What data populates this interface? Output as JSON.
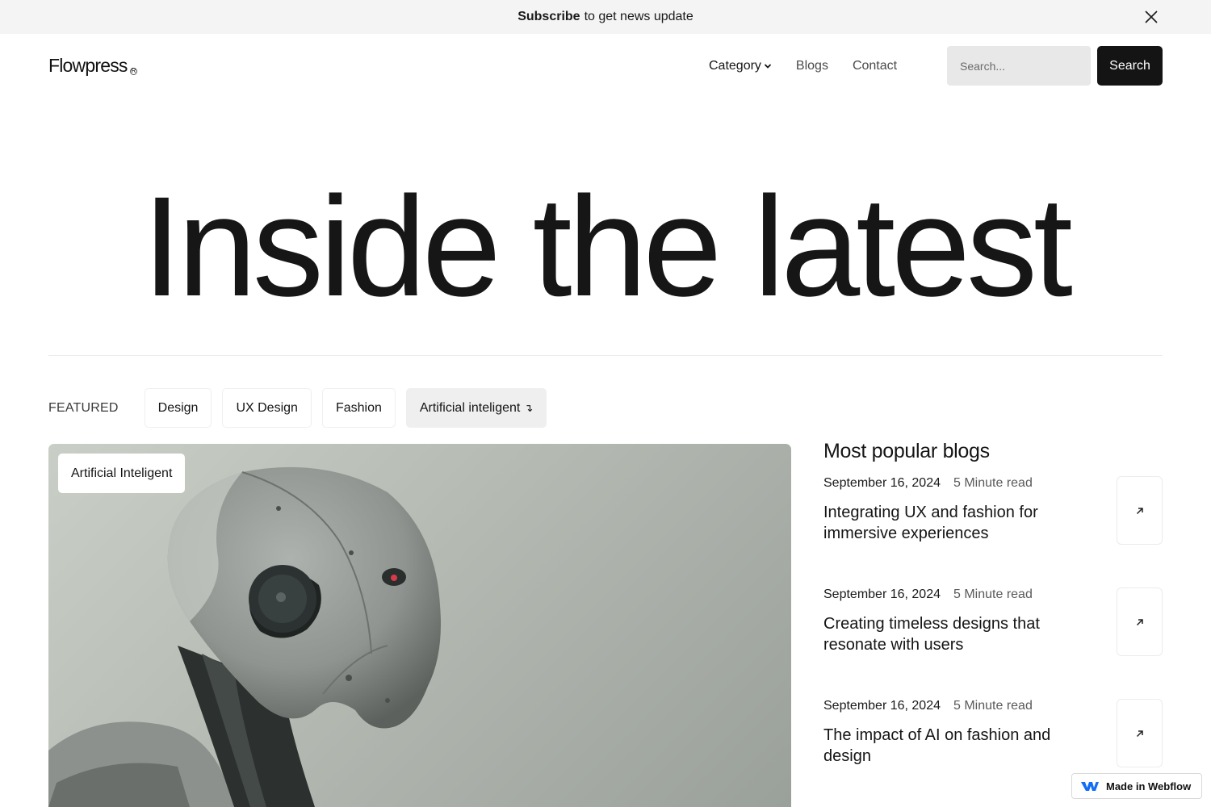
{
  "announcement": {
    "bold": "Subscribe",
    "text": "to get news update"
  },
  "header": {
    "logo": "Flowpress",
    "logo_mark": "R",
    "menu": [
      {
        "label": "Category",
        "dropdown": true
      },
      {
        "label": "Blogs"
      },
      {
        "label": "Contact"
      }
    ],
    "search": {
      "placeholder": "Search...",
      "button_label": "Search"
    }
  },
  "hero": {
    "title": "Inside the latest"
  },
  "featured": {
    "label": "FEATURED",
    "tags": [
      {
        "label": "Design",
        "active": false
      },
      {
        "label": "UX Design",
        "active": false
      },
      {
        "label": "Fashion",
        "active": false
      },
      {
        "label": "Artificial inteligent",
        "active": true
      }
    ],
    "active_arrow": "↴",
    "image_badge": "Artificial Inteligent",
    "image_subject": "robot-head"
  },
  "popular": {
    "title": "Most popular blogs",
    "posts": [
      {
        "date": "September 16, 2024",
        "read": "5 Minute read",
        "title": "Integrating UX and fashion for immersive experiences"
      },
      {
        "date": "September 16, 2024",
        "read": "5 Minute read",
        "title": "Creating timeless designs that resonate with users"
      },
      {
        "date": "September 16, 2024",
        "read": "5 Minute read",
        "title": "The impact of AI on fashion and design"
      }
    ],
    "arrow_icon": "arrow-up-right-icon"
  },
  "badge": {
    "label": "Made in Webflow"
  },
  "colors": {
    "dark": "#141414",
    "muted_bg": "#f4f4f4",
    "input_bg": "#e8e8e8"
  }
}
